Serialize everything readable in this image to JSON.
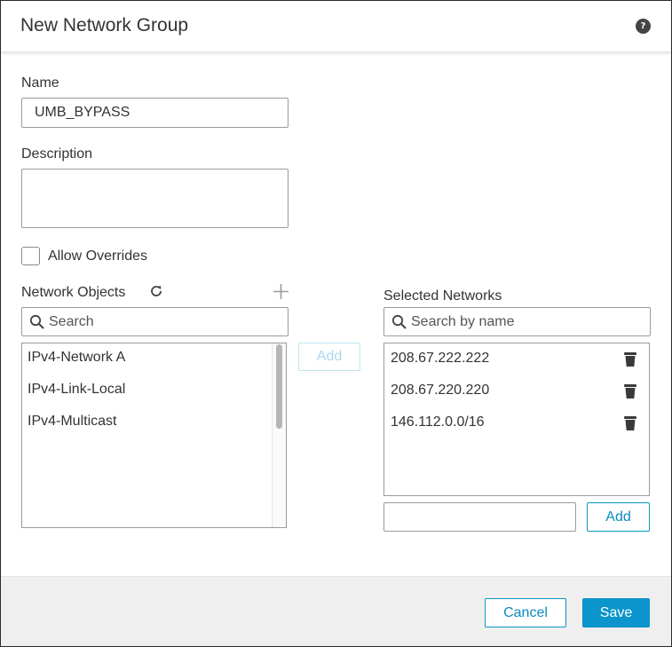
{
  "dialog": {
    "title": "New Network Group",
    "help_icon": "?"
  },
  "form": {
    "name_label": "Name",
    "name_value": "UMB_BYPASS",
    "description_label": "Description",
    "description_value": "",
    "allow_overrides_label": "Allow Overrides",
    "allow_overrides_checked": false
  },
  "network_objects": {
    "label": "Network Objects",
    "search_placeholder": "Search",
    "items": [
      "IPv4-Network A",
      "IPv4-Link-Local",
      "IPv4-Multicast"
    ],
    "add_button": "Add"
  },
  "selected_networks": {
    "label": "Selected Networks",
    "search_placeholder": "Search by name",
    "items": [
      "208.67.222.222",
      "208.67.220.220",
      "146.112.0.0/16"
    ],
    "manual_entry_value": "",
    "add_button": "Add"
  },
  "footer": {
    "cancel_label": "Cancel",
    "save_label": "Save"
  },
  "colors": {
    "accent": "#0c95cc",
    "footer_bg": "#efefef",
    "text": "#333333"
  },
  "icons": [
    "help-icon",
    "refresh-icon",
    "plus-icon",
    "search-icon",
    "trash-icon"
  ]
}
